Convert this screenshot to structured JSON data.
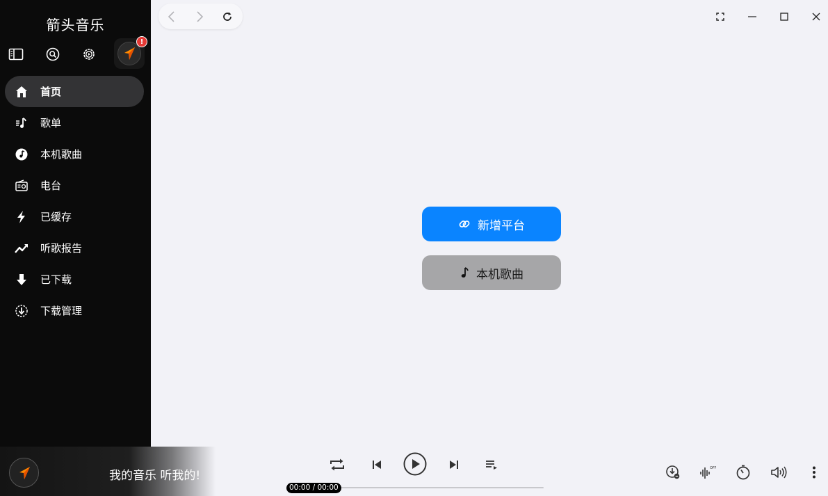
{
  "app": {
    "title": "箭头音乐"
  },
  "quick_icons": [
    "sidebar-toggle-icon",
    "search-icon",
    "settings-icon"
  ],
  "notification_badge": "!",
  "nav": {
    "items": [
      {
        "label": "首页",
        "icon": "home-icon",
        "active": true
      },
      {
        "label": "歌单",
        "icon": "playlist-icon"
      },
      {
        "label": "本机歌曲",
        "icon": "local-music-icon"
      },
      {
        "label": "电台",
        "icon": "radio-icon"
      },
      {
        "label": "已缓存",
        "icon": "cache-icon"
      },
      {
        "label": "听歌报告",
        "icon": "report-icon"
      },
      {
        "label": "已下载",
        "icon": "downloaded-icon"
      },
      {
        "label": "下载管理",
        "icon": "download-manager-icon"
      }
    ]
  },
  "main": {
    "add_platform_label": "新增平台",
    "local_music_label": "本机歌曲"
  },
  "player": {
    "slogan": "我的音乐 听我的!",
    "time": "00:00 / 00:00",
    "progress": 0
  },
  "colors": {
    "accent": "#0a84ff",
    "sidebar_bg": "#0b0b0b",
    "content_bg": "#f2f2f7",
    "badge": "#e53935"
  }
}
